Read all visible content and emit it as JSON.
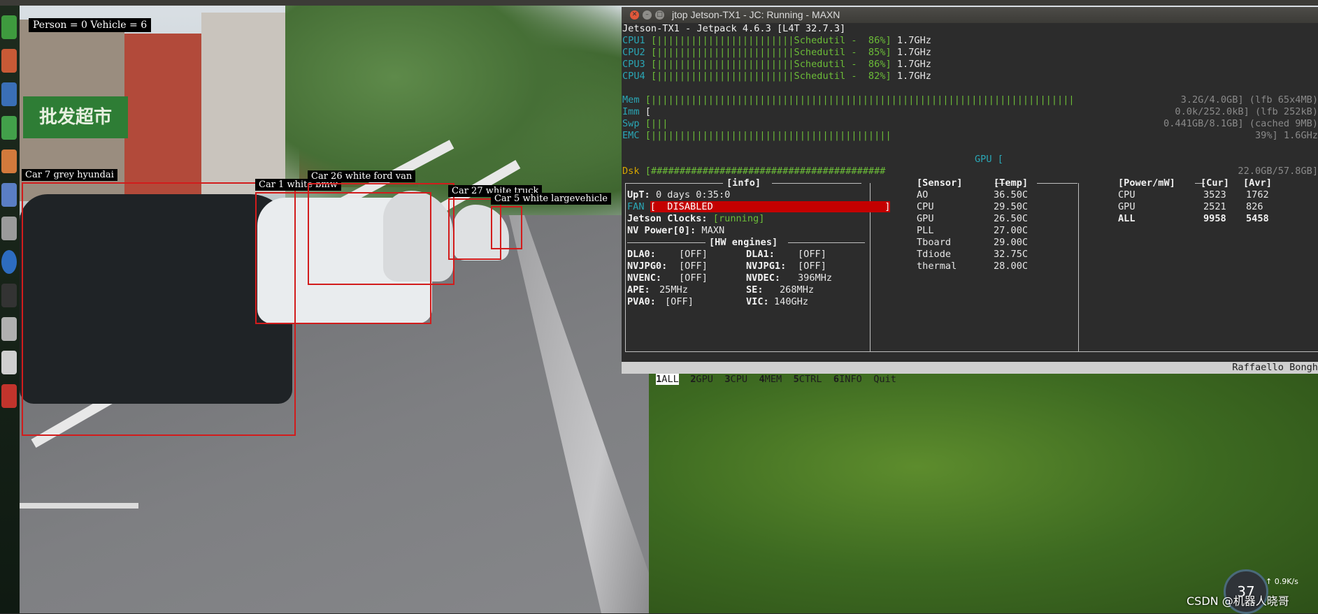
{
  "detection": {
    "counts": "Person = 0 Vehicle = 6",
    "labels": [
      "Car 7 grey  hyundai",
      "Car 1 white  bmw",
      "Car 26 white  ford  van",
      "Car 27 white  truck",
      "Car 5 white  largevehicle"
    ],
    "box_color": "#d21c1c",
    "sign_text": "批发超市"
  },
  "window": {
    "title": "jtop Jetson-TX1 - JC: Running - MAXN",
    "buttons": [
      "close",
      "minimize",
      "maximize"
    ]
  },
  "jtop": {
    "header": "Jetson-TX1 - Jetpack 4.6.3 [L4T 32.7.3]",
    "cpus": [
      {
        "name": "CPU1",
        "bar": "[||||||||||||||||||||||||Schedutil -  86%]",
        "freq": "1.7GHz"
      },
      {
        "name": "CPU2",
        "bar": "[||||||||||||||||||||||||Schedutil -  85%]",
        "freq": "1.7GHz"
      },
      {
        "name": "CPU3",
        "bar": "[||||||||||||||||||||||||Schedutil -  86%]",
        "freq": "1.7GHz"
      },
      {
        "name": "CPU4",
        "bar": "[||||||||||||||||||||||||Schedutil -  82%]",
        "freq": "1.7GHz"
      }
    ],
    "mem": {
      "label": "Mem",
      "bar": "[||||||||||||||||||||||||||||||||||||||||||||||||||||||||||||||||||||||||||",
      "value": "3.2G/4.0GB] (lfb 65x4MB)"
    },
    "imm": {
      "label": "Imm",
      "bar": "[",
      "value": "0.0k/252.0kB] (lfb 252kB)"
    },
    "swp": {
      "label": "Swp",
      "bar": "[|||",
      "value": "0.441GB/8.1GB] (cached 9MB)"
    },
    "emc": {
      "label": "EMC",
      "bar": "[||||||||||||||||||||||||||||||||||||||||||",
      "value": "39%] 1.6GHz"
    },
    "gpu": "GPU [",
    "dsk": {
      "label": "Dsk",
      "bar": "[#########################################",
      "value": "22.0GB/57.8GB]"
    },
    "info_title": "[info]",
    "uptime_label": "UpT:",
    "uptime": "0 days 0:35:0",
    "fan_label": "FAN",
    "fan_value": "[  DISABLED                              ]",
    "clocks_label": "Jetson Clocks:",
    "clocks_value": "[running]",
    "nvpower_label": "NV Power[0]:",
    "nvpower_value": "MAXN",
    "hw_title": "[HW engines]",
    "hw": [
      {
        "k1": "DLA0:",
        "v1": "[OFF]",
        "k2": "DLA1:",
        "v2": "[OFF]"
      },
      {
        "k1": "NVJPG0:",
        "v1": "[OFF]",
        "k2": "NVJPG1:",
        "v2": "[OFF]"
      },
      {
        "k1": "NVENC:",
        "v1": "[OFF]",
        "k2": "NVDEC:",
        "v2": "396MHz"
      },
      {
        "k1": "APE:",
        "v1": "25MHz",
        "k2": "SE:",
        "v2": "268MHz"
      },
      {
        "k1": "PVA0:",
        "v1": "[OFF]",
        "k2": "VIC:",
        "v2": "140GHz"
      }
    ],
    "sensor_title": "[Sensor]",
    "temp_title": "[Temp]",
    "sensors": [
      {
        "name": "AO",
        "temp": "36.50C"
      },
      {
        "name": "CPU",
        "temp": "29.50C"
      },
      {
        "name": "GPU",
        "temp": "26.50C"
      },
      {
        "name": "PLL",
        "temp": "27.00C"
      },
      {
        "name": "Tboard",
        "temp": "29.00C"
      },
      {
        "name": "Tdiode",
        "temp": "32.75C"
      },
      {
        "name": "thermal",
        "temp": "28.00C"
      }
    ],
    "power_title": "[Power/mW]",
    "cur_title": "[Cur]",
    "avr_title": "[Avr]",
    "power": [
      {
        "name": "CPU",
        "cur": "3523",
        "avr": "1762"
      },
      {
        "name": "GPU",
        "cur": "2521",
        "avr": "826"
      },
      {
        "name": "ALL",
        "cur": "9958",
        "avr": "5458"
      }
    ],
    "menu": [
      {
        "num": "1",
        "label": "ALL"
      },
      {
        "num": "2",
        "label": "GPU"
      },
      {
        "num": "3",
        "label": "CPU"
      },
      {
        "num": "4",
        "label": "MEM"
      },
      {
        "num": "5",
        "label": "CTRL"
      },
      {
        "num": "6",
        "label": "INFO"
      }
    ],
    "quit": "Quit",
    "author": "Raffaello Bongh"
  },
  "overlay": {
    "watermark": "CSDN @机器人晓哥",
    "speed_value": "37",
    "speed_rate": "0.9",
    "speed_unit": "K/s"
  }
}
